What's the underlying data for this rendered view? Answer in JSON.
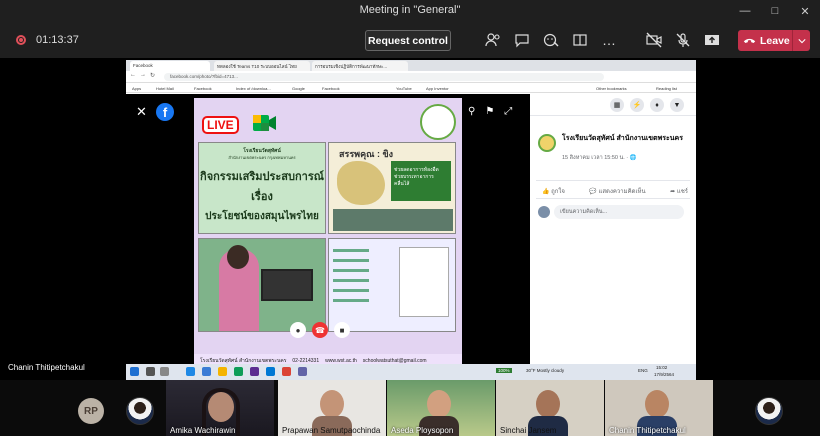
{
  "window": {
    "title": "Meeting in \"General\""
  },
  "meeting": {
    "timer": "01:13:37",
    "request_control": "Request control",
    "leave": "Leave",
    "sharer_name": "Chanin Thitipetchakul"
  },
  "browser": {
    "tabs": [
      "Facebook",
      "ทดลองใช้ Teams T10 ระบบออนไลน์ ไทย",
      "การอบรมเชิงปฏิบัติการพัฒนาทักษะ..."
    ],
    "url": "facebook.com/photo/?fbid=4713...",
    "bookmarks": [
      "Apps",
      "Hotel Mail",
      "Facebook",
      "Index of /downloa...",
      "Google",
      "Facebook",
      "YouTube",
      "App Inventor"
    ],
    "bookmarks_right": "Other bookmarks",
    "reading_list": "Reading list"
  },
  "facebook": {
    "page_name": "โรงเรียนวัดสุทัศน์ สำนักงานเขตพระนคร",
    "post_date": "15 สิงหาคม เวลา 15:50 น. · 🌐",
    "like": "ถูกใจ",
    "comment": "แสดงความคิดเห็น",
    "share": "แชร์",
    "comment_placeholder": "เขียนความคิดเห็น..."
  },
  "poster": {
    "live": "LIVE",
    "school_header": "โรงเรียนวัดสุทัศน์",
    "school_sub": "สำนักงานเขตพระนคร กรุงเทพมหานคร",
    "activity_line1": "กิจกรรมเสริมประสบการณ์",
    "activity_line2": "เรื่อง",
    "activity_line3": "ประโยชน์ของสมุนไพรไทย",
    "panel2_heading": "สรรพคุณ : ขิง",
    "panel2_note": "ช่วยลดอาการท้องอืด ช่วยบรรเทาอาการคลื่นไส้",
    "footer_school": "โรงเรียนวัดสุทัศน์ สำนักงานเขตพระนคร",
    "footer_phone": "02-2214331",
    "footer_web": "www.wst.ac.th",
    "footer_email": "schoolwatsuthat@gmail.com"
  },
  "taskbar": {
    "battery": "100%",
    "weather": "30°F  Mostly cloudy",
    "lang": "ENG",
    "time": "15:02",
    "date": "17/9/2564"
  },
  "participants": [
    {
      "initials": "RP"
    },
    {
      "name": "Amika Wachirawin"
    },
    {
      "name": "Prapawan Samutpaochinda"
    },
    {
      "name": "Aseda Ploysopon"
    },
    {
      "name": "Sinchai Jansem"
    },
    {
      "name": "Chanin Thitipetchakul"
    }
  ],
  "colors": {
    "leave": "#c4314b",
    "teams_bg": "#1f1f1f",
    "fb_blue": "#1877f2"
  }
}
